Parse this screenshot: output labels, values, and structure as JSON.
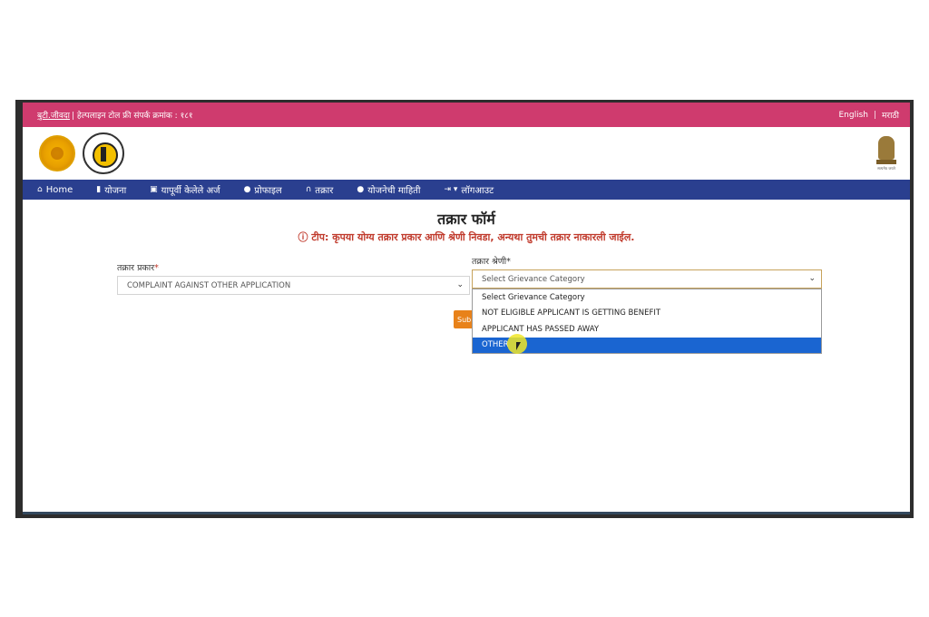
{
  "topbar": {
    "link": "बुटी.जीवदा",
    "helpline": "| हेल्पलाइन टोल फ्री संपर्क क्रमांक : १८१",
    "lang_en": "English",
    "lang_sep": "|",
    "lang_mr": "मराठी"
  },
  "emblem": {
    "motto": "सत्यमेव जयते"
  },
  "nav": {
    "home": "Home",
    "yojana": "योजना",
    "submitted": "यापूर्वी केलेले अर्ज",
    "profile": "प्रोफाइल",
    "complaint": "तक्रार",
    "scheme_info": "योजनेची माहिती",
    "logout": "लॉगआउट"
  },
  "form": {
    "title": "तक्रार फॉर्म",
    "tip": "ⓘ टीप: कृपया योग्य तक्रार प्रकार आणि श्रेणी निवडा, अन्यथा तुमची तक्रार नाकारली जाईल.",
    "type_label": "तक्रार प्रकार",
    "type_value": "COMPLAINT AGAINST OTHER APPLICATION",
    "category_label": "तक्रार श्रेणी",
    "category_placeholder": "Select Grievance Category",
    "required_mark": "*",
    "submit_label": "Submit"
  },
  "dropdown": {
    "options": [
      "Select Grievance Category",
      "NOT ELIGIBLE APPLICANT IS GETTING BENEFIT",
      "APPLICANT HAS PASSED AWAY",
      "OTHER"
    ],
    "highlighted_index": 3
  },
  "colors": {
    "topbar": "#cf3b6e",
    "navbar": "#2a3f8f",
    "tip": "#c0392b",
    "highlight": "#1a65d1",
    "submit": "#e8821a"
  }
}
